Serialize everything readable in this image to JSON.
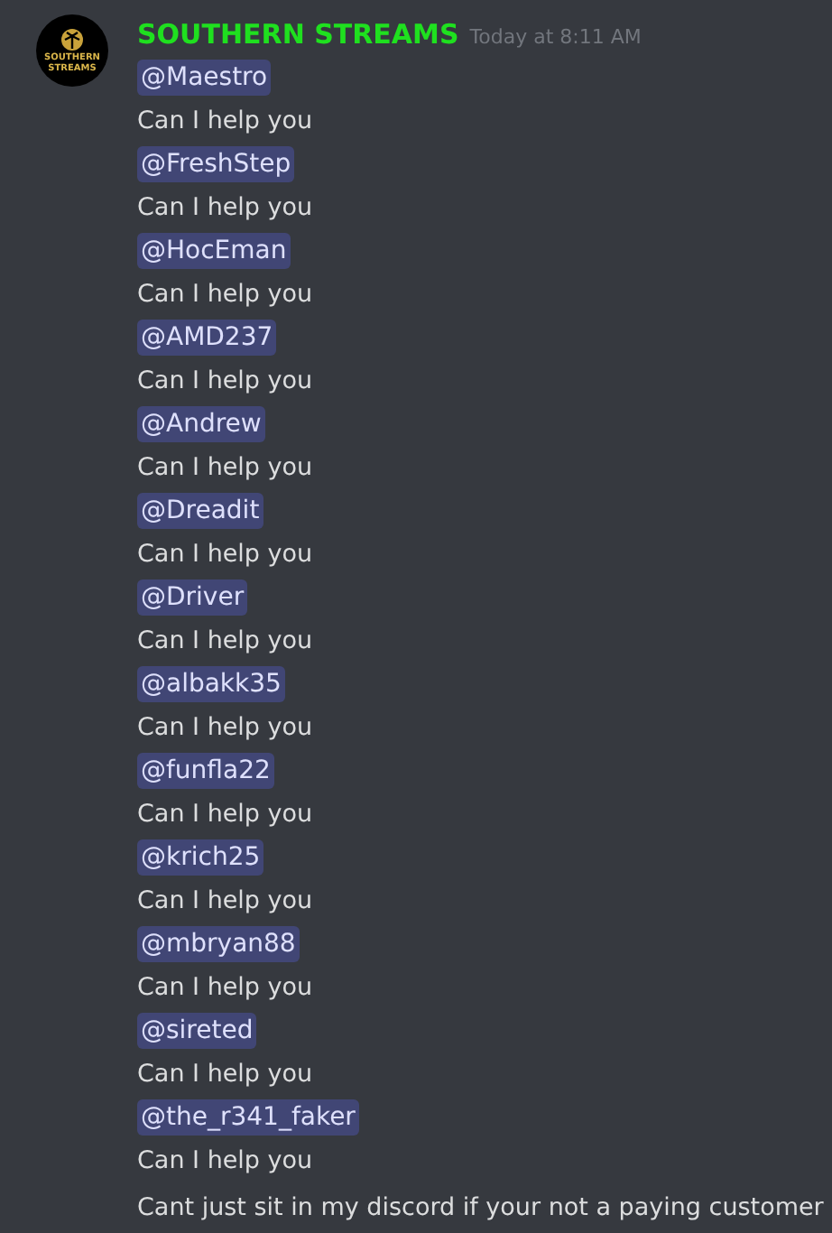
{
  "message": {
    "avatar_text": [
      "SOUTHERN",
      "STREAMS"
    ],
    "author": "SOUTHERN STREAMS",
    "timestamp": "Today at 8:11 AM",
    "lines": [
      {
        "kind": "mention",
        "text": "@Maestro"
      },
      {
        "kind": "text",
        "text": "Can I help you"
      },
      {
        "kind": "mention",
        "text": "@FreshStep"
      },
      {
        "kind": "text",
        "text": "Can I help you"
      },
      {
        "kind": "mention",
        "text": "@HocEman"
      },
      {
        "kind": "text",
        "text": "Can I help you"
      },
      {
        "kind": "mention",
        "text": "@AMD237"
      },
      {
        "kind": "text",
        "text": "Can I help you"
      },
      {
        "kind": "mention",
        "text": "@Andrew"
      },
      {
        "kind": "text",
        "text": "Can I help you"
      },
      {
        "kind": "mention",
        "text": "@Dreadit"
      },
      {
        "kind": "text",
        "text": "Can I help you"
      },
      {
        "kind": "mention",
        "text": "@Driver"
      },
      {
        "kind": "text",
        "text": "Can I help you"
      },
      {
        "kind": "mention",
        "text": "@albakk35"
      },
      {
        "kind": "text",
        "text": "Can I help you"
      },
      {
        "kind": "mention",
        "text": "@funfla22"
      },
      {
        "kind": "text",
        "text": "Can I help you"
      },
      {
        "kind": "mention",
        "text": "@krich25"
      },
      {
        "kind": "text",
        "text": "Can I help you"
      },
      {
        "kind": "mention",
        "text": "@mbryan88"
      },
      {
        "kind": "text",
        "text": "Can I help you"
      },
      {
        "kind": "mention",
        "text": "@sireted"
      },
      {
        "kind": "text",
        "text": "Can I help you"
      },
      {
        "kind": "mention",
        "text": "@the_r341_faker"
      },
      {
        "kind": "text",
        "text": "Can I help you"
      },
      {
        "kind": "text",
        "text": "Cant just sit in my discord if your not a paying customer"
      }
    ]
  }
}
